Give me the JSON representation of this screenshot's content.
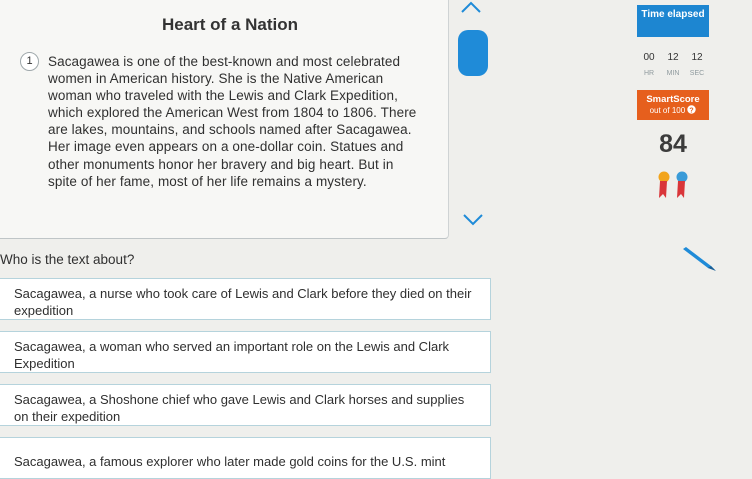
{
  "passage": {
    "title": "Heart of a Nation",
    "paragraph_number": "1",
    "text": "Sacagawea is one of the best-known and most celebrated women in American history. She is the Native American woman who traveled with the Lewis and Clark Expedition, which explored the American West from 1804 to 1806. There are lakes, mountains, and schools named after Sacagawea. Her image even appears on a one-dollar coin. Statues and other monuments honor her bravery and big heart. But in spite of her fame, most of her life remains a mystery."
  },
  "timer": {
    "label": "Time elapsed",
    "hours": "00",
    "minutes": "12",
    "seconds": "12",
    "hours_unit": "HR",
    "minutes_unit": "MIN",
    "seconds_unit": "SEC"
  },
  "score": {
    "label": "SmartScore",
    "sub_label": "out of 100",
    "value": "84"
  },
  "question": {
    "prompt": "Who is the text about?",
    "choices": [
      "Sacagawea, a nurse who took care of Lewis and Clark before they died on their expedition",
      "Sacagawea, a woman who served an important role on the Lewis and Clark Expedition",
      "Sacagawea, a Shoshone chief who gave Lewis and Clark horses and supplies on their expedition",
      "Sacagawea, a famous explorer who later made gold coins for the U.S. mint"
    ]
  },
  "colors": {
    "accent_blue": "#1f8bd8",
    "score_orange": "#e65f1d",
    "choice_border": "#b5d3dc"
  },
  "icons": [
    "chevron-up-icon",
    "chevron-down-icon",
    "help-icon",
    "ribbon-icon",
    "pencil-icon"
  ]
}
